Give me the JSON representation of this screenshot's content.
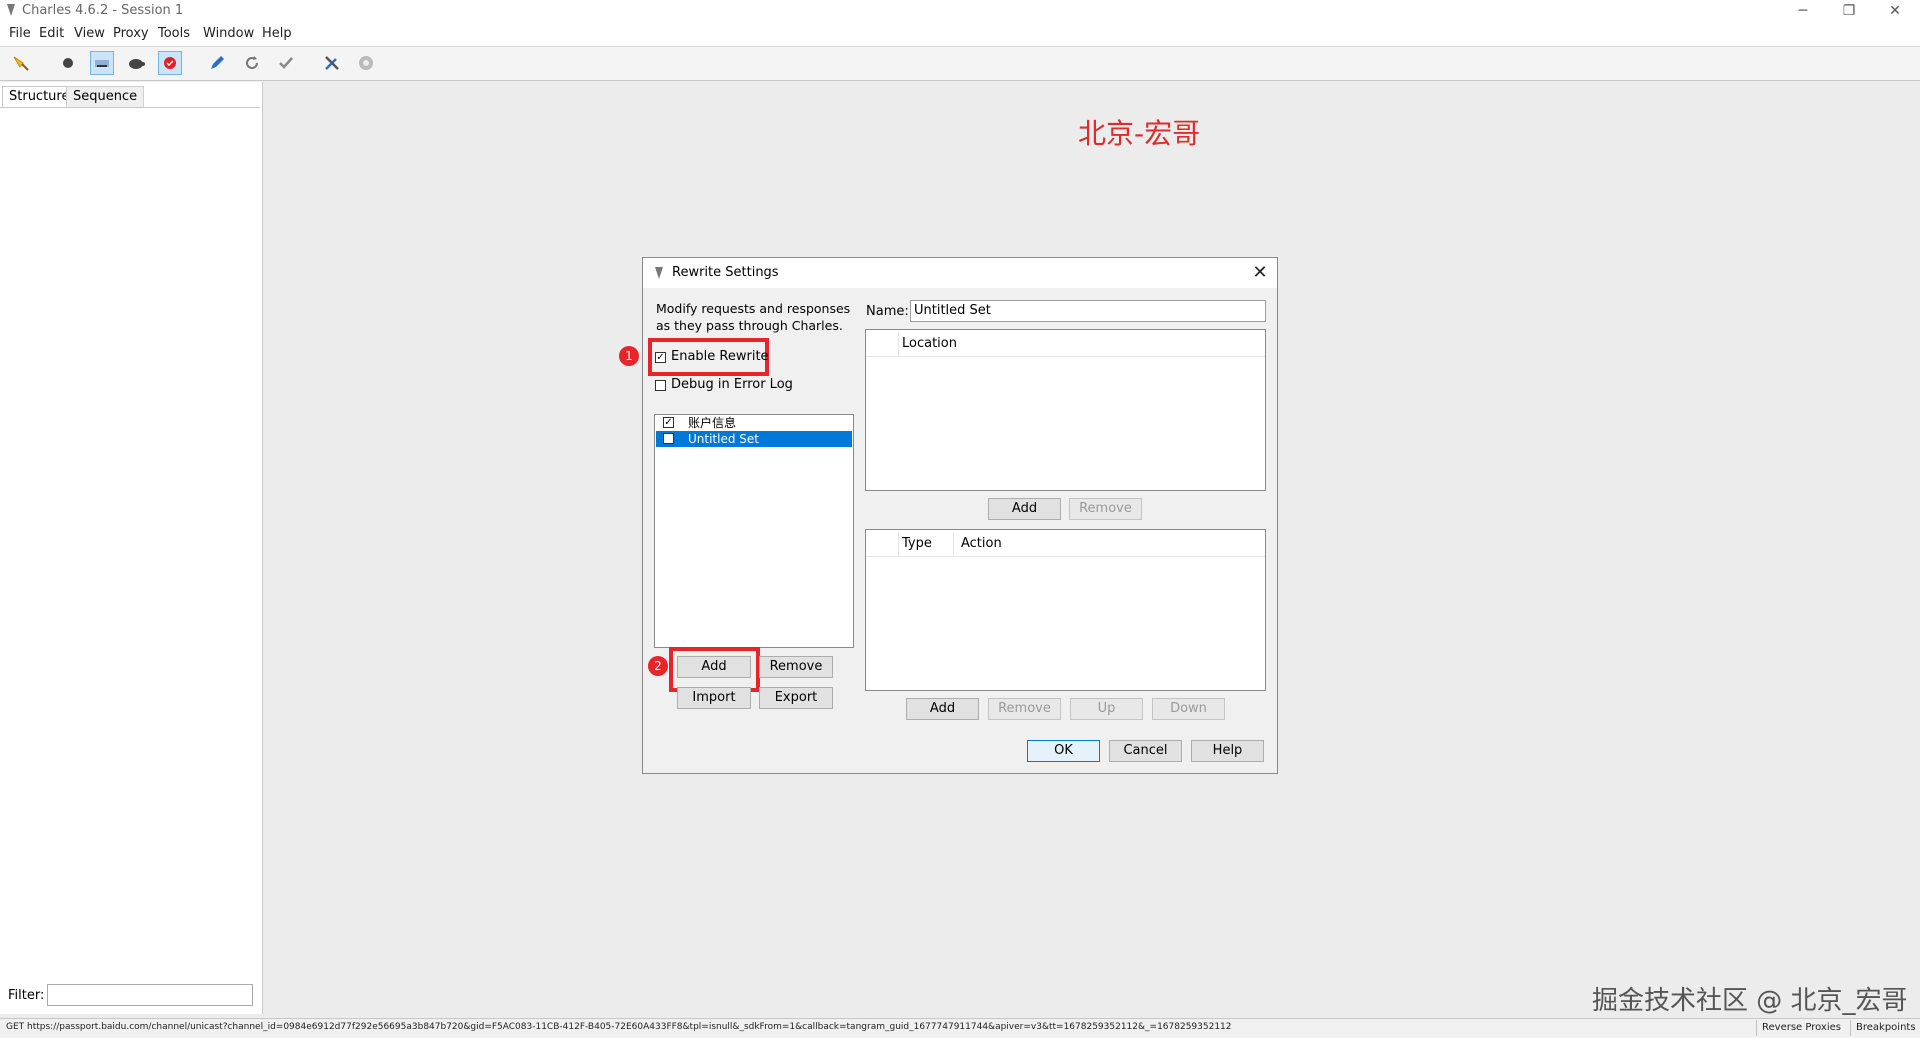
{
  "window": {
    "title": "Charles 4.6.2 - Session 1",
    "controls": [
      "─",
      "❐",
      "✕"
    ]
  },
  "menu": [
    "File",
    "Edit",
    "View",
    "Proxy",
    "Tools",
    "Window",
    "Help"
  ],
  "toolbar": [
    "broom-icon",
    "record-icon",
    "throttle-icon",
    "turtle-icon",
    "breakpoint-icon",
    "pen-icon",
    "refresh-icon",
    "check-icon",
    "tools-icon",
    "settings-icon"
  ],
  "left_panel": {
    "tabs": [
      "Structure",
      "Sequence"
    ],
    "filter_label": "Filter:"
  },
  "watermarks": {
    "top": "北京-宏哥",
    "bottom": "掘金技术社区 @ 北京_宏哥"
  },
  "dialog": {
    "title": "Rewrite Settings",
    "description": "Modify requests and responses as they pass through Charles.",
    "enable_rewrite": {
      "label": "Enable Rewrite",
      "checked": true
    },
    "debug_log": {
      "label": "Debug in Error Log",
      "checked": false
    },
    "sets": [
      {
        "label": "账户信息",
        "checked": true,
        "selected": false
      },
      {
        "label": "Untitled Set",
        "checked": true,
        "selected": true
      }
    ],
    "set_buttons": {
      "add": "Add",
      "remove": "Remove",
      "import": "Import",
      "export": "Export"
    },
    "name_label": "Name:",
    "name_value": "Untitled Set",
    "location_table": {
      "header": "Location"
    },
    "location_buttons": {
      "add": "Add",
      "remove": "Remove"
    },
    "rules_table": {
      "type_header": "Type",
      "action_header": "Action"
    },
    "rule_buttons": {
      "add": "Add",
      "remove": "Remove",
      "up": "Up",
      "down": "Down"
    },
    "footer": {
      "ok": "OK",
      "cancel": "Cancel",
      "help": "Help"
    },
    "annotations": [
      "1",
      "2"
    ]
  },
  "status": {
    "url": "GET https://passport.baidu.com/channel/unicast?channel_id=0984e6912d77f292e56695a3b847b720&gid=F5AC083-11CB-412F-B405-72E60A433FF8&tpl=isnull&_sdkFrom=1&callback=tangram_guid_1677747911744&apiver=v3&tt=1678259352112&_=1678259352112",
    "reverse_proxies": "Reverse Proxies",
    "breakpoints": "Breakpoints"
  },
  "colors": {
    "accent_red": "#e52528",
    "selection": "#0078d7"
  }
}
